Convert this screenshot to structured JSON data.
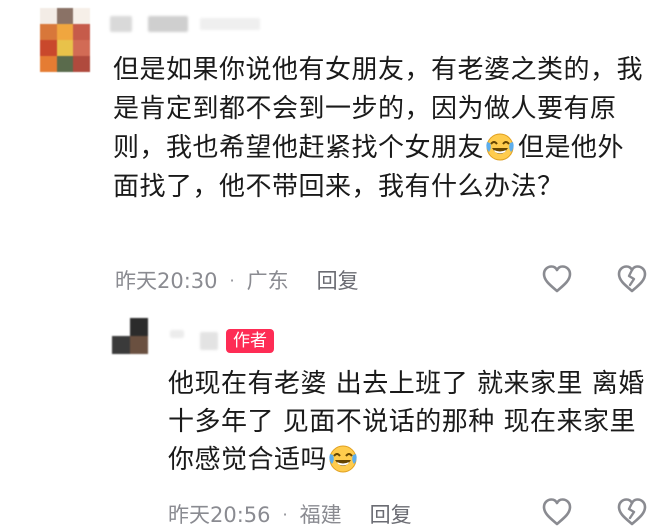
{
  "comment": {
    "username": "",
    "text": "但是如果你说他有女朋友，有老婆之类的，我是肯定到都不会到一步的，因为做人要有原则，我也希望他赶紧找个女朋友",
    "emoji": "laughing-crying-emoji",
    "text_after_emoji": "但是他外面找了，他不带回来，我有什么办法？",
    "time": "昨天20:30",
    "location": "广东",
    "reply_label": "回复"
  },
  "reply": {
    "username": "",
    "badge": "作者",
    "text": "他现在有老婆 出去上班了 就来家里 离婚十多年了 见面不说话的那种 现在来家里 你感觉合适吗",
    "emoji": "laughing-crying-emoji",
    "time": "昨天20:56",
    "location": "福建",
    "reply_label": "回复"
  },
  "colors": {
    "badge": "#fe2c55",
    "meta": "#8a8b91",
    "text": "#1a1a1a"
  },
  "icons": [
    "heart-outline-icon",
    "broken-heart-icon"
  ]
}
